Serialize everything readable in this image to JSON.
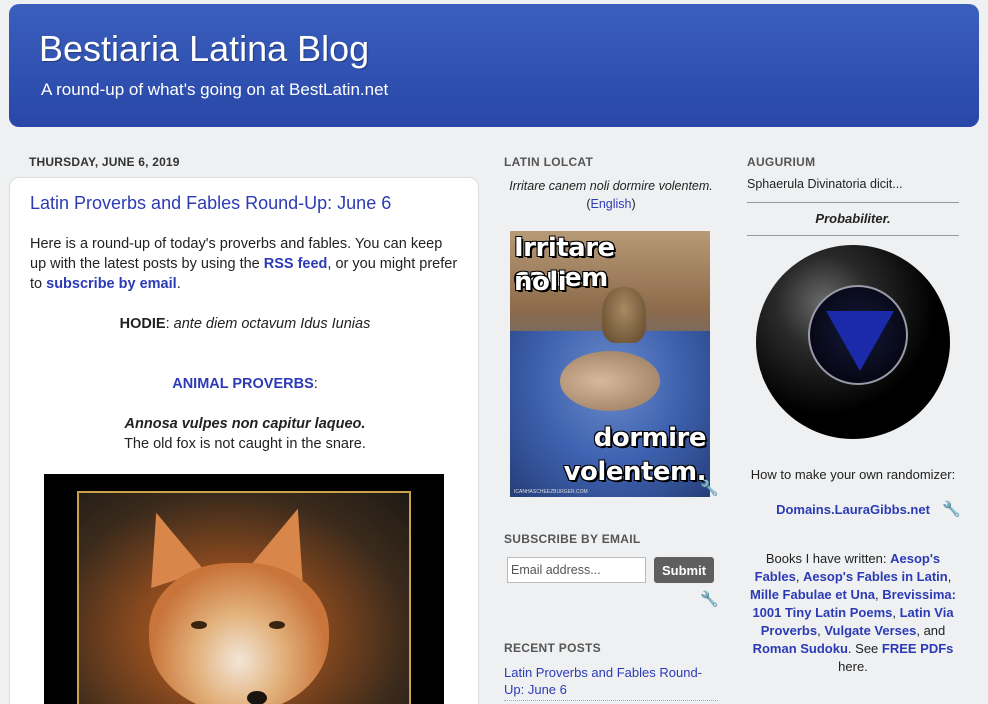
{
  "header": {
    "title": "Bestiaria Latina Blog",
    "description": "A round-up of what's going on at BestLatin.net"
  },
  "post": {
    "date": "THURSDAY, JUNE 6, 2019",
    "title": "Latin Proverbs and Fables Round-Up: June 6",
    "intro_1": "Here is a round-up of today's proverbs and fables. You can keep up with the latest posts by using the ",
    "rss_link": "RSS feed",
    "intro_2": ", or you might prefer to ",
    "email_link": "subscribe by email",
    "intro_3": ".",
    "hodie_label": "HODIE",
    "hodie_sep": ": ",
    "hodie_text": "ante diem octavum Idus Iunias",
    "section_link": "ANIMAL PROVERBS",
    "section_colon": ":",
    "proverb_latin": "Annosa vulpes non capitur laqueo.",
    "proverb_english": "The old fox is not caught in the snare."
  },
  "lolcat": {
    "heading": "LATIN LOLCAT",
    "caption": "Irritare canem noli dormire volentem.",
    "caption_open": " (",
    "english_link": "English",
    "caption_close": ")",
    "line1": "Irritare canem",
    "line2": "noli",
    "line3": "dormire",
    "line4": "volentem.",
    "source": "ICANHASCHEEZBURGER.COM"
  },
  "subscribe": {
    "heading": "SUBSCRIBE BY EMAIL",
    "placeholder": "Email address...",
    "submit_label": "Submit"
  },
  "recent": {
    "heading": "RECENT POSTS",
    "posts": [
      "Latin Proverbs and Fables Round-Up: June 6"
    ]
  },
  "augurium": {
    "heading": "AUGURIUM",
    "intro": "Sphaerula Divinatoria dicit...",
    "answer": "Probabiliter.",
    "howto": "How to make your own randomizer:",
    "link": "Domains.LauraGibbs.net"
  },
  "books": {
    "prefix": "Books I have written: ",
    "b1": "Aesop's Fables",
    "s1": ", ",
    "b2": "Aesop's Fables in Latin",
    "s2": ", ",
    "b3": "Mille Fabulae et Una",
    "s3": ", ",
    "b4": "Brevissima: 1001 Tiny Latin Poems",
    "s4": ", ",
    "b5": "Latin Via Proverbs",
    "s5": ", ",
    "b6": "Vulgate Verses",
    "s6": ", and ",
    "b7": "Roman Sudoku",
    "s7": ". See ",
    "b8": "FREE PDFs",
    "s8": " here."
  }
}
